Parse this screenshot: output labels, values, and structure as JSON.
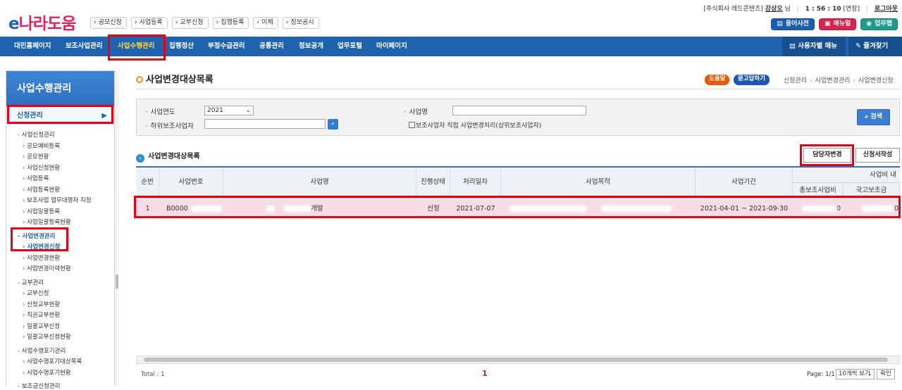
{
  "header": {
    "logo_e": "e",
    "logo_text": "나라도움",
    "quick_links": [
      "공모신청",
      "사업등록",
      "교부신청",
      "집행등록",
      "이체",
      "정보공시"
    ],
    "user_prefix": "[주식회사 레드콘텐츠]",
    "user_name": "강상오",
    "user_suffix": "님",
    "time": "1 : 56 : 10",
    "extend": "[연장]",
    "logout": "로그아웃",
    "glossary": "용어사전",
    "manual": "매뉴얼",
    "workmap": "업무맵"
  },
  "gnb": {
    "items": [
      "대민홈페이지",
      "보조사업관리",
      "사업수행관리",
      "집행정산",
      "부정수급관리",
      "공통관리",
      "정보공개",
      "업무포털",
      "마이페이지"
    ],
    "active": "사업수행관리",
    "user_menu": "사용자별 메뉴",
    "favorites": "즐겨찾기"
  },
  "lnb": {
    "title": "사업수행관리",
    "section": "신청관리",
    "tree": [
      {
        "t": "g",
        "label": "사업신청관리"
      },
      {
        "t": "c",
        "label": "공모예비등록"
      },
      {
        "t": "c",
        "label": "공모현황"
      },
      {
        "t": "c",
        "label": "사업신청현황"
      },
      {
        "t": "c",
        "label": "사업등록"
      },
      {
        "t": "c",
        "label": "사업등록현황"
      },
      {
        "t": "c",
        "label": "보조사업 업무대행자 지정"
      },
      {
        "t": "c",
        "label": "사업일괄등록"
      },
      {
        "t": "c",
        "label": "사업일괄등록현황"
      },
      {
        "t": "g",
        "label": "사업변경관리",
        "cur": true
      },
      {
        "t": "c",
        "label": "사업변경신청",
        "cur": true
      },
      {
        "t": "c",
        "label": "사업변경현황"
      },
      {
        "t": "c",
        "label": "사업변경이력현황"
      },
      {
        "t": "g",
        "label": "교부관리"
      },
      {
        "t": "c",
        "label": "교부신청"
      },
      {
        "t": "c",
        "label": "신청교부현황"
      },
      {
        "t": "c",
        "label": "직권교부현황"
      },
      {
        "t": "c",
        "label": "일괄교부신청"
      },
      {
        "t": "c",
        "label": "일괄교부신청현황"
      },
      {
        "t": "g",
        "label": "사업수행포기관리"
      },
      {
        "t": "c",
        "label": "사업수행포기대상목록"
      },
      {
        "t": "c",
        "label": "사업수행포기현황"
      },
      {
        "t": "g",
        "label": "보조금신청관리"
      }
    ]
  },
  "page": {
    "title": "사업변경대상목록",
    "help": "도움말",
    "faq": "묻고답하기",
    "breadcrumb": [
      "신청관리",
      "사업변경관리",
      "사업변경신청"
    ]
  },
  "search": {
    "year_label": "사업연도",
    "year_value": "2021",
    "sub_label": "하위보조사업자",
    "sub_value": "",
    "name_label": "사업명",
    "name_value": "",
    "checkbox_label": "보조사업자 직접 사업변경처리(상위보조사업자)",
    "button": "검색"
  },
  "list": {
    "title": "사업변경대상목록",
    "btn_manager": "담당자변경",
    "btn_write": "신청서작성",
    "columns": [
      "순번",
      "사업번호",
      "사업명",
      "진행상태",
      "처리일자",
      "사업목적",
      "사업기간"
    ],
    "group_header": "사업비 내",
    "sub_columns": [
      "총보조사업비",
      "국고보조금"
    ],
    "rows": [
      {
        "no": "1",
        "biz_no": "B0000",
        "biz_name": "개발",
        "status": "선정",
        "date": "2021-07-07",
        "purpose": "",
        "period": "2021-04-01 ~ 2021-09-30",
        "total": "0",
        "national": "0"
      }
    ]
  },
  "pager": {
    "total": "Total : 1",
    "current": "1",
    "page": "Page: 1/1",
    "per_page": "10개씩 보기",
    "confirm": "확인"
  },
  "colors": {
    "brand_blue": "#1f62ad",
    "highlight": "#e60012",
    "row_pink": "#f8dce6",
    "help": "#e8590c",
    "faq": "#1c56b5"
  }
}
